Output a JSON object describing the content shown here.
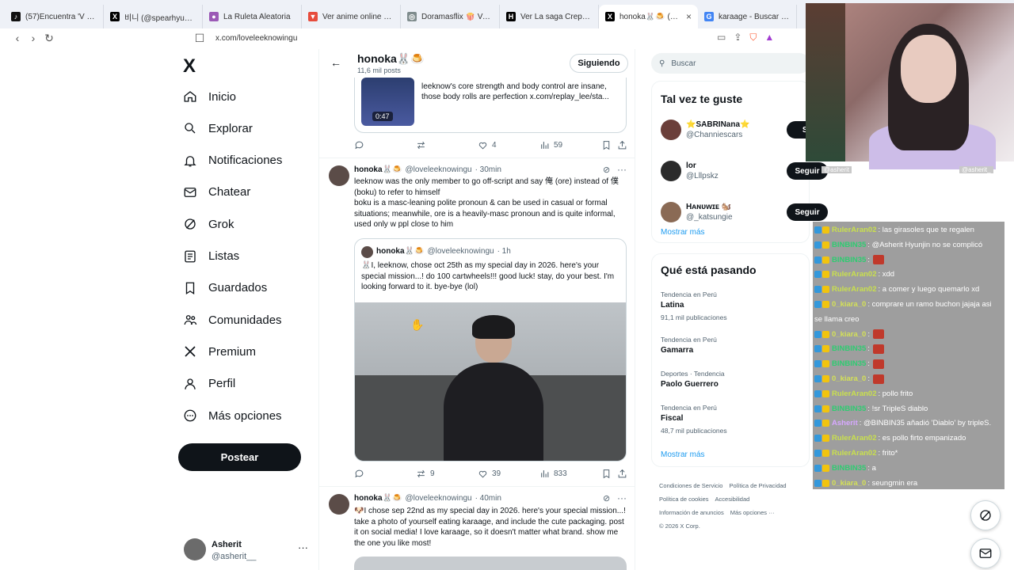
{
  "browser": {
    "tabs": [
      {
        "title": "(57)Encuentra 'V x I.N' en",
        "color": "#111111",
        "glyph": "♪"
      },
      {
        "title": "비니 (@spearhyunnie) / X",
        "color": "#000000",
        "glyph": "X"
      },
      {
        "title": "La Ruleta Aleatoria",
        "color": "#9b59b6",
        "glyph": "●"
      },
      {
        "title": "Ver anime online - Anime",
        "color": "#e74c3c",
        "glyph": "▼"
      },
      {
        "title": "Doramasflix 🍿 Ver Doram",
        "color": "#7f8c8d",
        "glyph": "◎"
      },
      {
        "title": "Ver La saga Crepúsculo: La",
        "color": "#000000",
        "glyph": "H"
      },
      {
        "title": "honoka🐰🍮 (@love",
        "color": "#000000",
        "glyph": "X",
        "active": true
      },
      {
        "title": "karaage - Buscar con Goo",
        "color": "#4285f4",
        "glyph": "G"
      }
    ],
    "close_glyph": "×",
    "url": "x.com/loveleeknowingu"
  },
  "sidebar": {
    "logo": "X",
    "items": [
      {
        "label": "Inicio",
        "icon": "home-icon"
      },
      {
        "label": "Explorar",
        "icon": "search-icon"
      },
      {
        "label": "Notificaciones",
        "icon": "bell-icon"
      },
      {
        "label": "Chatear",
        "icon": "mail-icon"
      },
      {
        "label": "Grok",
        "icon": "grok-icon"
      },
      {
        "label": "Listas",
        "icon": "list-icon"
      },
      {
        "label": "Guardados",
        "icon": "bookmark-icon"
      },
      {
        "label": "Comunidades",
        "icon": "people-icon"
      },
      {
        "label": "Premium",
        "icon": "x-icon"
      },
      {
        "label": "Perfil",
        "icon": "person-icon"
      },
      {
        "label": "Más opciones",
        "icon": "more-circle-icon"
      }
    ],
    "post_label": "Postear",
    "profile": {
      "name": "Asherit",
      "handle": "@asherit__",
      "more": "···"
    }
  },
  "header": {
    "name": "honoka🐰🍮",
    "posts": "11,6 mil posts",
    "follow_label": "Siguiendo"
  },
  "tweets": {
    "card_top": {
      "duration": "0:47",
      "text": "leeknow's core strength and body control are insane, those body rolls are perfection  x.com/replay_lee/sta..."
    },
    "t0_actions": {
      "reply": "",
      "retweet": "",
      "like": "4",
      "views": "59"
    },
    "t1": {
      "name": "honoka🐰🍮",
      "handle": "@loveleeknowingu",
      "time": "· 30min",
      "text": "leeknow was the only member to go off-script and say 俺 (ore) instead of 僕 (boku) to refer to himself\nboku is a masc-leaning polite pronoun & can be used in casual or formal situations; meanwhile, ore is a heavily-masc pronoun and is quite informal, used only w ppl close to him",
      "quote": {
        "name": "honoka🐰🍮",
        "handle": "@loveleeknowingu",
        "time": "· 1h",
        "text": "🐰I, leeknow, chose oct 25th as my special day in 2026. here's your special mission...! do 100 cartwheels!!! good luck! stay, do your best. I'm looking forward to it. bye-bye (lol)"
      },
      "actions": {
        "reply": "",
        "retweet": "9",
        "like": "39",
        "views": "833"
      }
    },
    "t2": {
      "name": "honoka🐰🍮",
      "handle": "@loveleeknowingu",
      "time": "· 40min",
      "text": "🐶I chose sep 22nd as my special day in 2026. here's your special mission...! take a photo of yourself eating karaage, and include the cute packaging. post it on social media! I love karaage, so it doesn't matter what brand. show me the one you like most!"
    },
    "more": "···"
  },
  "right": {
    "search_placeholder": "Buscar",
    "wtf_title": "Tal vez te guste",
    "wtf": [
      {
        "name": "⭐SABRINana⭐",
        "handle": "@Channiescars",
        "btn": "Se",
        "color": "#6b3f3a"
      },
      {
        "name": "lor",
        "handle": "@Lllpskz",
        "btn": "Seguir",
        "color": "#2b2b2b"
      },
      {
        "name": "Hᴀɴᴜᴡɪᴇ 🐿️",
        "handle": "@_katsungie",
        "btn": "Seguir",
        "color": "#8a6a55"
      }
    ],
    "show_more": "Mostrar más",
    "trends_title": "Qué está pasando",
    "trends": [
      {
        "meta": "Tendencia en Perú",
        "name": "Latina",
        "count": "91,1 mil publicaciones"
      },
      {
        "meta": "Tendencia en Perú",
        "name": "Gamarra",
        "count": ""
      },
      {
        "meta": "Deportes · Tendencia",
        "name": "Paolo Guerrero",
        "count": ""
      },
      {
        "meta": "Tendencia en Perú",
        "name": "Fiscal",
        "count": "48,7 mil publicaciones"
      }
    ],
    "trends_more": "Mostrar más",
    "footer": [
      "Condiciones de Servicio",
      "Política de Privacidad",
      "Política de cookies",
      "Accesibilidad",
      "Información de anuncios",
      "Más opciones ···",
      "© 2026 X Corp."
    ]
  },
  "stream": {
    "label_left": "@asherit",
    "label_right": "@asherit_",
    "chat": [
      {
        "user": "RulerAran02",
        "msg": ": las girasoles que te regalen",
        "color": "#c9e04d"
      },
      {
        "user": "BINBIN35",
        "msg": ": @Asherit Hyunjin no se complicó",
        "color": "#2ecc71"
      },
      {
        "user": "BINBIN35",
        "msg": ":",
        "color": "#2ecc71",
        "emote": true
      },
      {
        "user": "RulerAran02",
        "msg": ": xdd",
        "color": "#c9e04d"
      },
      {
        "user": "RulerAran02",
        "msg": ": a comer y luego quemarlo xd",
        "color": "#c9e04d"
      },
      {
        "user": "0_kiara_0",
        "msg": ": comprare un ramo buchon jajaja asi",
        "color": "#d4e157"
      },
      {
        "user": "",
        "msg": "se llama creo",
        "color": "#ffffff"
      },
      {
        "user": "0_kiara_0",
        "msg": ":",
        "color": "#d4e157",
        "emote": true
      },
      {
        "user": "BINBIN35",
        "msg": ":",
        "color": "#2ecc71",
        "emote": true
      },
      {
        "user": "BINBIN35",
        "msg": ":",
        "color": "#2ecc71",
        "emote": true
      },
      {
        "user": "0_kiara_0",
        "msg": ":",
        "color": "#d4e157",
        "emote": true
      },
      {
        "user": "RulerAran02",
        "msg": ": pollo frito",
        "color": "#c9e04d"
      },
      {
        "user": "BINBIN35",
        "msg": ": !sr TripleS diablo",
        "color": "#2ecc71"
      },
      {
        "user": "Asherit",
        "msg": ": @BINBIN35 añadió 'Diablo' by tripleS.",
        "color": "#d7a8ff"
      },
      {
        "user": "RulerAran02",
        "msg": ": es pollo firto empanizado",
        "color": "#c9e04d"
      },
      {
        "user": "RulerAran02",
        "msg": ": frito*",
        "color": "#c9e04d"
      },
      {
        "user": "BINBIN35",
        "msg": ": a",
        "color": "#2ecc71"
      },
      {
        "user": "0_kiara_0",
        "msg": ": seungmin era",
        "color": "#d4e157"
      }
    ]
  }
}
